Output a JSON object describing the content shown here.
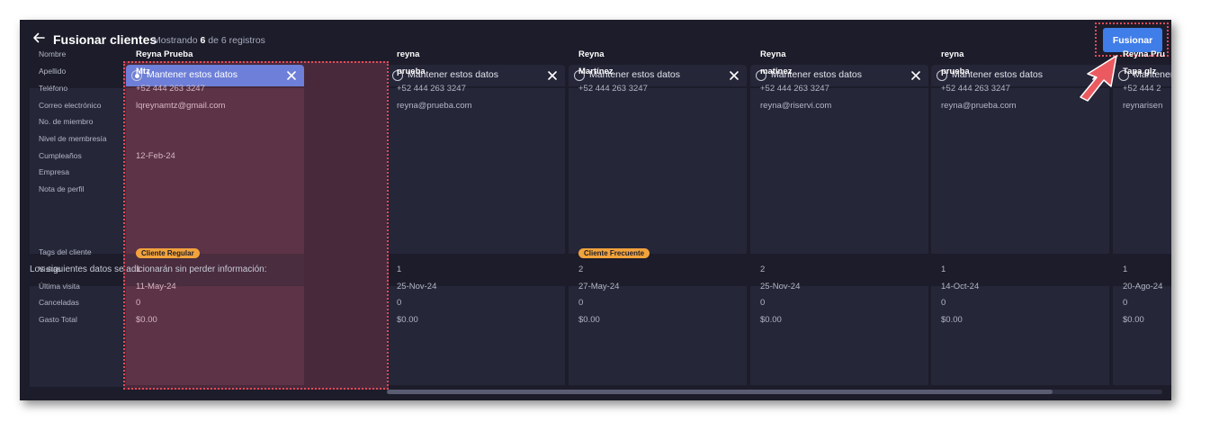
{
  "header": {
    "title": "Fusionar clientes",
    "subtitle_prefix": "Mostrando",
    "subtitle_count": "6",
    "subtitle_suffix": "de 6 registros",
    "merge_label": "Fusionar"
  },
  "fields_top": [
    "Nombre",
    "Apellido",
    "Teléfono",
    "Correo electrónico",
    "No. de miembro",
    "Nivel de membresía",
    "Cumpleaños",
    "Empresa",
    "Nota de perfil"
  ],
  "section_text": "Los siguientes datos se adicionarán sin perder información:",
  "fields_bottom": [
    "Tags del cliente",
    "Visitas",
    "Última visita",
    "Canceladas",
    "Gasto Total"
  ],
  "keep_label": "Mantener estos datos",
  "records": [
    {
      "nombre": "Reyna Prueba",
      "apellido": "Mtz",
      "telefono": "+52 444 263 3247",
      "correo": "lqreynamtz@gmail.com",
      "cumpleanos": "12-Feb-24",
      "tag": "Cliente Regular",
      "visitas": "1",
      "ultima_visita": "11-May-24",
      "canceladas": "0",
      "gasto": "$0.00"
    },
    {
      "nombre": "reyna",
      "apellido": "prueba",
      "telefono": "+52 444 263 3247",
      "correo": "reyna@prueba.com",
      "cumpleanos": "",
      "tag": "",
      "visitas": "1",
      "ultima_visita": "25-Nov-24",
      "canceladas": "0",
      "gasto": "$0.00"
    },
    {
      "nombre": "Reyna",
      "apellido": "Martínez",
      "telefono": "+52 444 263 3247",
      "correo": "",
      "cumpleanos": "",
      "tag": "Cliente Frecuente",
      "visitas": "2",
      "ultima_visita": "27-May-24",
      "canceladas": "0",
      "gasto": "$0.00"
    },
    {
      "nombre": "Reyna",
      "apellido": "matinez",
      "telefono": "+52 444 263 3247",
      "correo": "reyna@riservi.com",
      "cumpleanos": "",
      "tag": "",
      "visitas": "2",
      "ultima_visita": "25-Nov-24",
      "canceladas": "0",
      "gasto": "$0.00"
    },
    {
      "nombre": "reyna",
      "apellido": "prueba",
      "telefono": "+52 444 263 3247",
      "correo": "reyna@prueba.com",
      "cumpleanos": "",
      "tag": "",
      "visitas": "1",
      "ultima_visita": "14-Oct-24",
      "canceladas": "0",
      "gasto": "$0.00"
    },
    {
      "nombre": "Reyna Pru",
      "apellido": "Tapa glz",
      "telefono": "+52 444 2",
      "correo": "reynarisen",
      "cumpleanos": "",
      "tag": "",
      "visitas": "1",
      "ultima_visita": "20-Ago-24",
      "canceladas": "0",
      "gasto": "$0.00"
    }
  ],
  "selected_index": 0,
  "colors": {
    "accent": "#3f7de8",
    "tag": "#f2a33c",
    "highlight": "#e44a57",
    "selected_header": "#6d7fd8"
  }
}
